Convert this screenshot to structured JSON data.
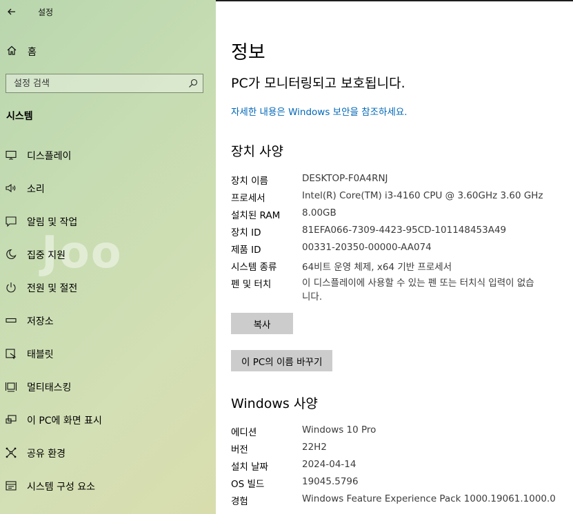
{
  "window": {
    "title": "설정",
    "back_icon": "back-arrow-icon"
  },
  "sidebar": {
    "home_label": "홈",
    "search_placeholder": "설정 검색",
    "section_title": "시스템",
    "watermark": "Joo",
    "items": [
      {
        "label": "디스플레이",
        "icon": "display-icon"
      },
      {
        "label": "소리",
        "icon": "speaker-icon"
      },
      {
        "label": "알림 및 작업",
        "icon": "notification-icon"
      },
      {
        "label": "집중 지원",
        "icon": "moon-icon"
      },
      {
        "label": "전원 및 절전",
        "icon": "power-icon"
      },
      {
        "label": "저장소",
        "icon": "storage-icon"
      },
      {
        "label": "태블릿",
        "icon": "tablet-icon"
      },
      {
        "label": "멀티태스킹",
        "icon": "multitasking-icon"
      },
      {
        "label": "이 PC에 화면 표시",
        "icon": "project-icon"
      },
      {
        "label": "공유 환경",
        "icon": "shared-icon"
      },
      {
        "label": "시스템 구성 요소",
        "icon": "components-icon"
      }
    ]
  },
  "main": {
    "title": "정보",
    "status": "PC가 모니터링되고 보호됩니다.",
    "security_link": "자세한 내용은 Windows 보안을 참조하세요.",
    "device_specs_title": "장치 사양",
    "device_specs": [
      {
        "key": "장치 이름",
        "value": "DESKTOP-F0A4RNJ"
      },
      {
        "key": "프로세서",
        "value": "Intel(R) Core(TM) i3-4160 CPU @ 3.60GHz   3.60 GHz"
      },
      {
        "key": "설치된 RAM",
        "value": "8.00GB"
      },
      {
        "key": "장치 ID",
        "value": "81EFA066-7309-4423-95CD-101148453A49"
      },
      {
        "key": "제품 ID",
        "value": "00331-20350-00000-AA074"
      },
      {
        "key": "시스템 종류",
        "value": "64비트 운영 체제, x64 기반 프로세서"
      },
      {
        "key": "펜 및 터치",
        "value": "이 디스플레이에 사용할 수 있는 펜 또는 터치식 입력이 없습니다."
      }
    ],
    "copy_button": "복사",
    "rename_button": "이 PC의 이름 바꾸기",
    "windows_specs_title": "Windows 사양",
    "windows_specs": [
      {
        "key": "에디션",
        "value": "Windows 10 Pro"
      },
      {
        "key": "버전",
        "value": "22H2"
      },
      {
        "key": "설치 날짜",
        "value": "2024-04-14"
      },
      {
        "key": "OS 빌드",
        "value": "19045.5796"
      },
      {
        "key": "경험",
        "value": "Windows Feature Experience Pack 1000.19061.1000.0"
      }
    ]
  }
}
